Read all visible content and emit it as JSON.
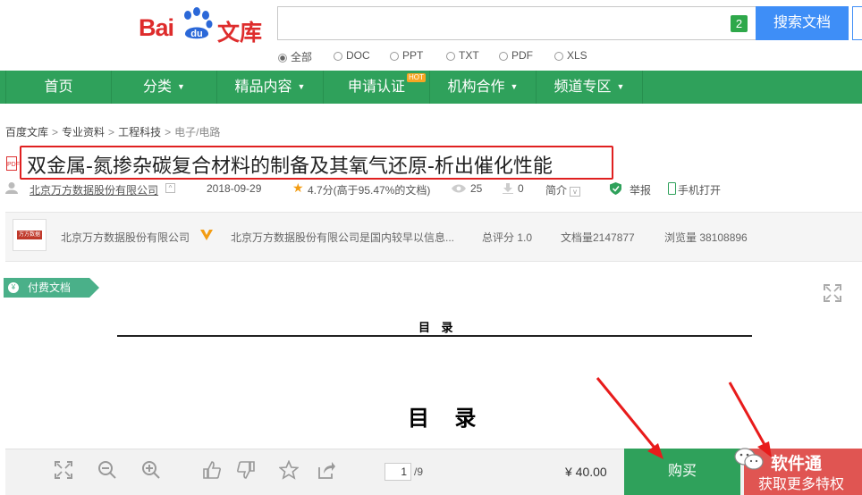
{
  "header": {
    "logo_text_left": "Bai",
    "logo_paw_text": "du",
    "logo_text_right": "文库",
    "search_placeholder": "",
    "search_badge": "2",
    "search_button": "搜索文档"
  },
  "filters": [
    {
      "label": "全部",
      "selected": true
    },
    {
      "label": "DOC",
      "selected": false
    },
    {
      "label": "PPT",
      "selected": false
    },
    {
      "label": "TXT",
      "selected": false
    },
    {
      "label": "PDF",
      "selected": false
    },
    {
      "label": "XLS",
      "selected": false
    }
  ],
  "nav": {
    "items": [
      "首页",
      "分类",
      "精品内容",
      "申请认证",
      "机构合作",
      "频道专区"
    ],
    "hot_badge": "HOT"
  },
  "breadcrumb": [
    "百度文库",
    "专业资料",
    "工程科技",
    "电子/电路"
  ],
  "doc": {
    "format_icon": "PDF",
    "title": "双金属-氮掺杂碳复合材料的制备及其氧气还原-析出催化性能",
    "uploader": "北京万方数据股份有限公司",
    "date": "2018-09-29",
    "rating": "4.7分(高于95.47%的文档)",
    "views": "25",
    "downloads": "0",
    "intro_label": "简介",
    "report": "举报",
    "mobile_open": "手机打开"
  },
  "publisher": {
    "logo_text": "万方数据",
    "name": "北京万方数据股份有限公司",
    "desc": "北京万方数据股份有限公司是国内较早以信息...",
    "score": "总评分 1.0",
    "doc_count": "文档量2147877",
    "view_count": "浏览量 38108896"
  },
  "preview": {
    "paid_tag": "付费文档",
    "heading_small": "目 录",
    "heading_large": "目 录"
  },
  "toolbar": {
    "page_current": "1",
    "page_total": "/9",
    "price": "¥ 40.00",
    "buy": "购买",
    "watermark": "软件通",
    "vip": "获取更多特权"
  },
  "colors": {
    "brand_red": "#de2c2c",
    "nav_green": "#2fa15b",
    "search_blue": "#3e8ef7",
    "highlight_red": "#e02020"
  }
}
